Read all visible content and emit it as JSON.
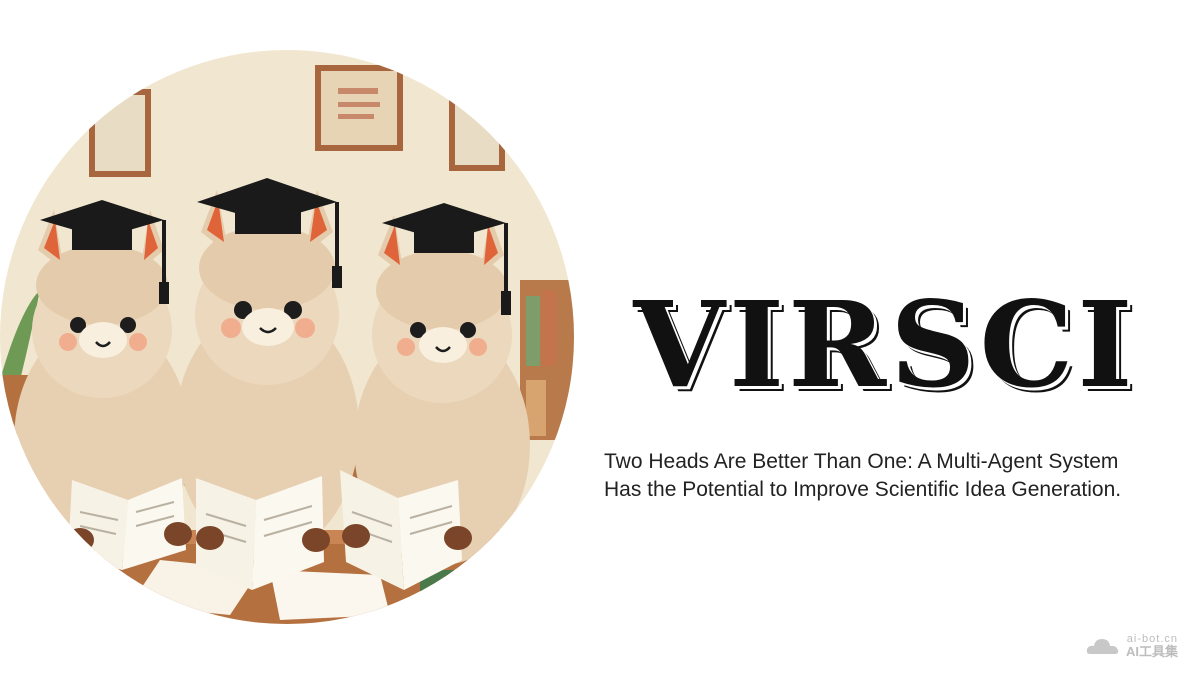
{
  "hero": {
    "title": "VIRSCI",
    "subtitle_line1": "Two Heads Are Better Than One: A Multi-Agent System",
    "subtitle_line2": "Has the Potential to Improve Scientific Idea Generation."
  },
  "illustration": {
    "subject": "llama-scholars-reading-papers"
  },
  "watermark": {
    "url": "ai-bot.cn",
    "name": "AI工具集",
    "icon": "cloud-logo-icon"
  },
  "colors": {
    "title": "#111111",
    "subtitle": "#222222",
    "wool": "#ecd7bd",
    "background": "#ffffff"
  }
}
